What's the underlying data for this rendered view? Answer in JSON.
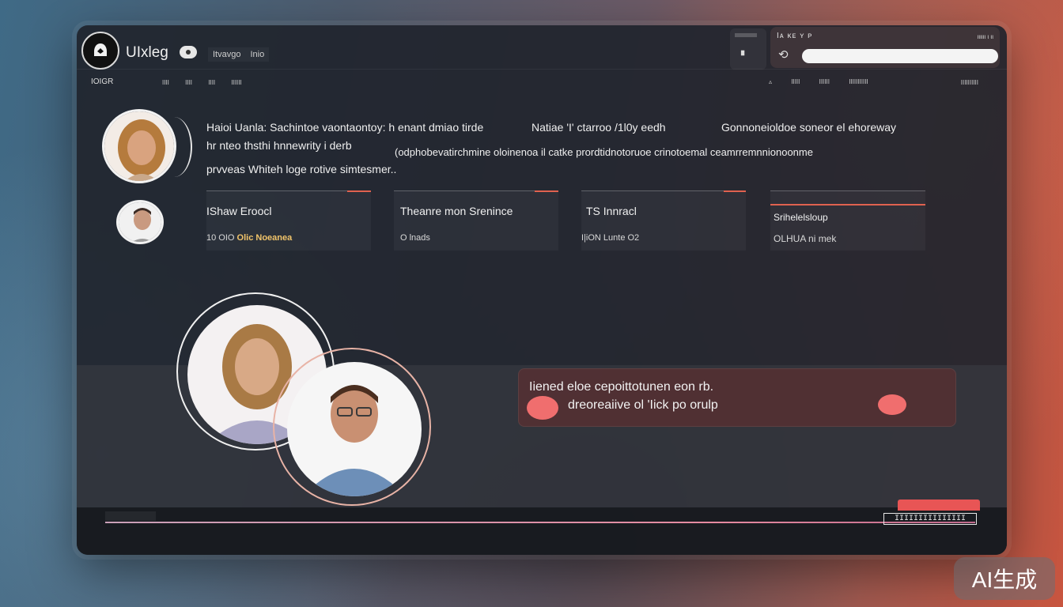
{
  "header": {
    "app_name": "UIxleg",
    "breadcrumb": [
      "Itvavgo",
      "Inio"
    ],
    "search_title": "Iᴀ ᴋᴇ ʏ ᴘ",
    "search_meta": "ιιιιιι ι ιι",
    "search_value": "",
    "icons": {
      "logo": "hooded-figure-icon",
      "eye": "eye-icon",
      "refresh": "refresh-icon"
    }
  },
  "subnav": {
    "home": "IOIGR",
    "links": [
      "IIII",
      "IIII",
      "IIII",
      "IIIIII"
    ],
    "right_links": [
      "▵",
      "IIIII",
      "IIIIII",
      "IIIIIIIIIII"
    ],
    "far_link": "IIIIIIIIII"
  },
  "profile": {
    "desc_line1_a": "Haioi Uanla: Sachintoe vaontaontoy: h enant dmiao tirde",
    "desc_line1_b": "Natiae 'I' ctarroo /1l0y eedh",
    "desc_line1_c": "Gonnoneioldoe soneor el ehoreway",
    "desc_line2_a": "hr nteo thsthi hnnewrity i derb",
    "desc_line2_b": "(odphobevatirchmine oloinenoa il catke prordtidnotoruoe crinotoemal ceamrremnnionoonme",
    "desc_line3": "prvveas Whiteh loge rotive simtesmer.."
  },
  "cards": [
    {
      "title": "IShaw Eroocl",
      "meta_prefix": "10 OIO",
      "meta_accent": "Olic Noeanea"
    },
    {
      "title": "Theanre mon Srenince",
      "meta_prefix": "O lnads",
      "meta_accent": ""
    },
    {
      "title": "TS Innracl",
      "meta_prefix": "I|iON Lunte O2",
      "meta_accent": ""
    },
    {
      "title": "Srihelelsloup",
      "meta_prefix": "OLHUA ni mek",
      "meta_accent": ""
    }
  ],
  "message": {
    "line1": "Iiened eloe cepoittotunen eon rb.",
    "line2": "dreoreaiive ol 'Iick po orulp",
    "icons": {
      "left": "heart-icon",
      "right": "heart-icon"
    }
  },
  "footer": {
    "send_label": "IIIIIIIIIIIIIII"
  },
  "watermark": "AI生成",
  "colors": {
    "accent": "#e0624f",
    "heart": "#f06e6e",
    "card_meta": "#f1c46a"
  }
}
